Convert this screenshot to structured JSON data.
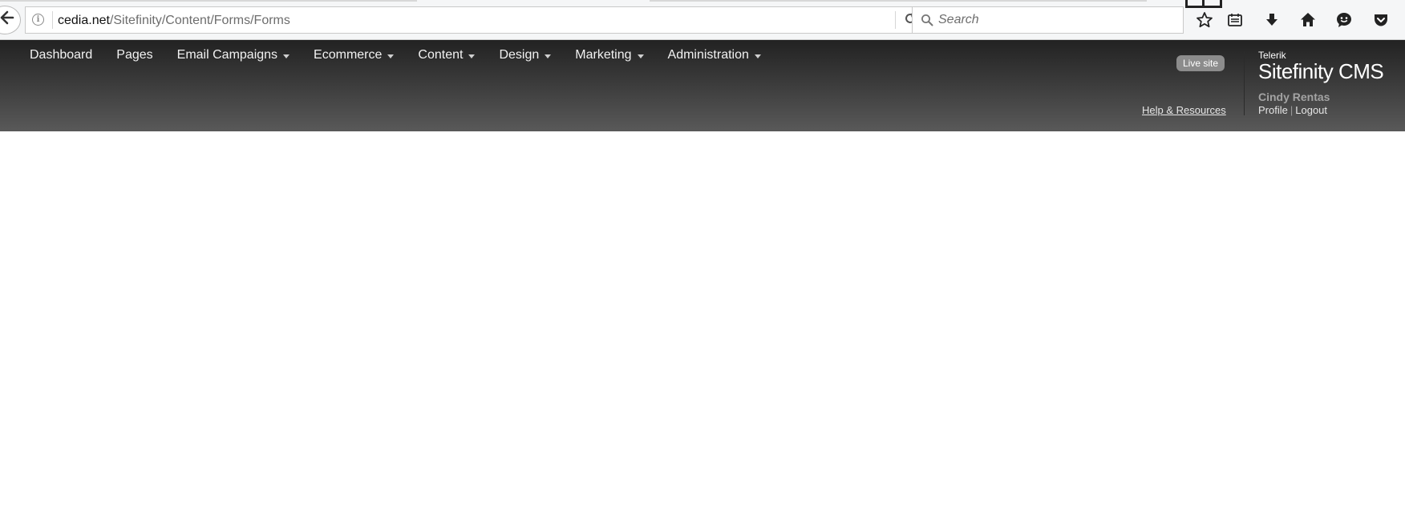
{
  "browser": {
    "url_domain": "cedia.net",
    "url_path": "/Sitefinity/Content/Forms/Forms",
    "search_placeholder": "Search",
    "icons": [
      "back-arrow-icon",
      "info-icon",
      "reload-icon",
      "search-icon",
      "bookmark-star-icon",
      "reading-list-icon",
      "download-icon",
      "home-icon",
      "smiley-icon",
      "pocket-icon"
    ]
  },
  "nav": {
    "items": [
      {
        "label": "Dashboard",
        "has_dropdown": false
      },
      {
        "label": "Pages",
        "has_dropdown": false
      },
      {
        "label": "Email Campaigns",
        "has_dropdown": true
      },
      {
        "label": "Ecommerce",
        "has_dropdown": true
      },
      {
        "label": "Content",
        "has_dropdown": true
      },
      {
        "label": "Design",
        "has_dropdown": true
      },
      {
        "label": "Marketing",
        "has_dropdown": true
      },
      {
        "label": "Administration",
        "has_dropdown": true
      }
    ]
  },
  "header": {
    "live_site": "Live site",
    "help": "Help & Resources",
    "brand_small": "Telerik",
    "brand_name": "Sitefinity",
    "brand_suffix": "CMS",
    "user_name": "Cindy Rentas",
    "profile": "Profile",
    "separator": "|",
    "logout": "Logout"
  },
  "colors": {
    "header_top": "#222222",
    "header_bottom": "#595959",
    "live_site_bg": "#8c8c8c"
  }
}
